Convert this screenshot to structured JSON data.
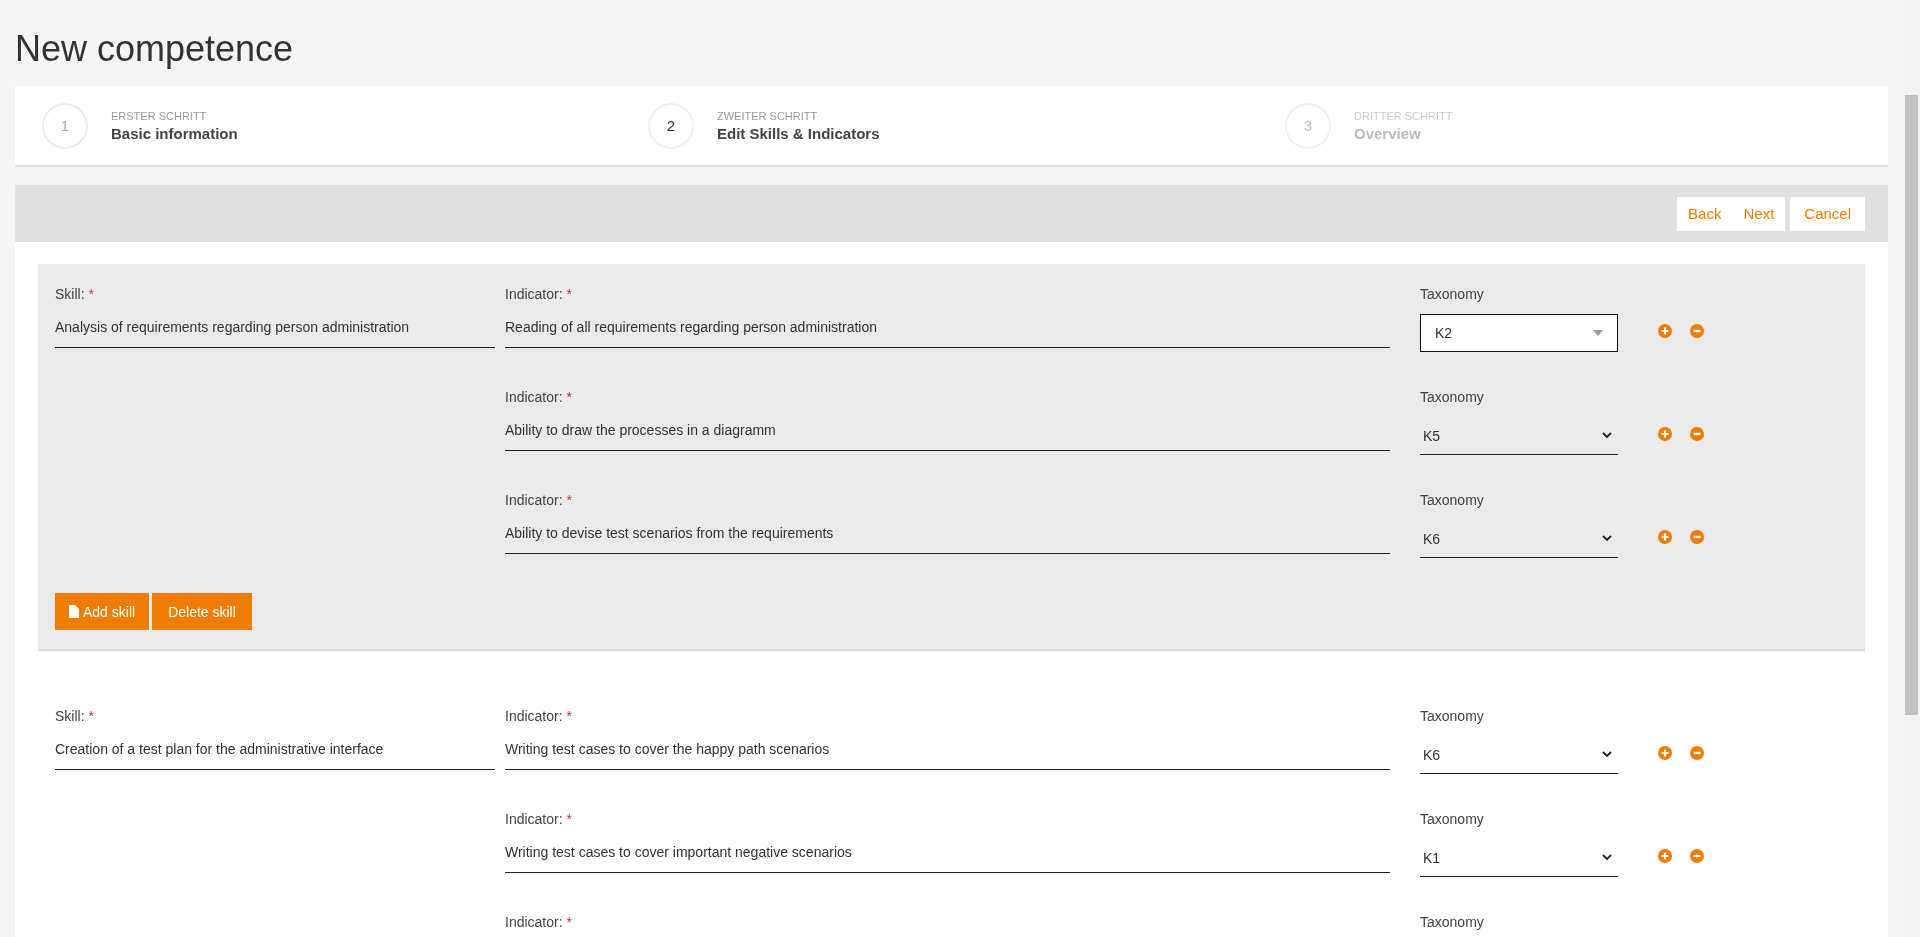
{
  "page_title": "New competence",
  "steps": [
    {
      "number": "1",
      "caption": "ERSTER SCHRITT",
      "title": "Basic information",
      "completed": true,
      "selected": false
    },
    {
      "number": "2",
      "caption": "ZWEITER SCHRITT",
      "title": "Edit Skills & Indicators",
      "completed": false,
      "selected": true
    },
    {
      "number": "3",
      "caption": "DRITTER SCHRITT",
      "title": "Overview",
      "completed": false,
      "selected": false
    }
  ],
  "toolbar": {
    "nav_buttons": [
      "Back",
      "Next"
    ],
    "cancel_button": "Cancel"
  },
  "skills": [
    {
      "selected": true,
      "skill_label": "Skill:",
      "required_mark": "*",
      "skill_value": "Analysis of requirements regarding person administration",
      "indicators": [
        {
          "label": "Indicator:",
          "required_mark": "*",
          "value": "Reading of all requirements regarding person administration",
          "focused": false,
          "taxonomy_label": "Taxonomy",
          "taxonomy_value": "K2",
          "taxonomy_open": true
        },
        {
          "label": "Indicator:",
          "required_mark": "*",
          "value": "Ability to draw the processes in a diagramm",
          "focused": false,
          "taxonomy_label": "Taxonomy",
          "taxonomy_value": "K5",
          "taxonomy_open": false
        },
        {
          "label": "Indicator:",
          "required_mark": "*",
          "value": "Ability to devise test scenarios from the requirements",
          "focused": false,
          "taxonomy_label": "Taxonomy",
          "taxonomy_value": "K6",
          "taxonomy_open": false
        }
      ],
      "add_button": "Add skill",
      "delete_button": "Delete skill"
    },
    {
      "selected": false,
      "skill_label": "Skill:",
      "required_mark": "*",
      "skill_value": "Creation of a test plan for the administrative interface",
      "indicators": [
        {
          "label": "Indicator:",
          "required_mark": "*",
          "value": "Writing test cases to cover the happy path scenarios",
          "focused": false,
          "taxonomy_label": "Taxonomy",
          "taxonomy_value": "K6",
          "taxonomy_open": false
        },
        {
          "label": "Indicator:",
          "required_mark": "*",
          "value": "Writing test cases to cover important negative scenarios",
          "focused": false,
          "taxonomy_label": "Taxonomy",
          "taxonomy_value": "K1",
          "taxonomy_open": false
        },
        {
          "label": "Indicator:",
          "required_mark": "*",
          "taxonomy_label": "Taxonomy"
        }
      ]
    }
  ]
}
